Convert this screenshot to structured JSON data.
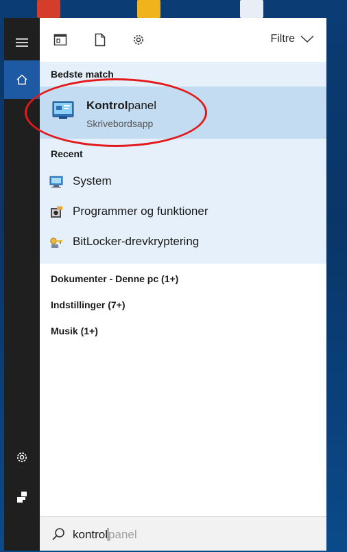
{
  "toolbar": {
    "filter_label": "Filtre"
  },
  "best_match": {
    "title": "Bedste match",
    "item": {
      "title_bold": "Kontrol",
      "title_rest": "panel",
      "subtitle": "Skrivebordsapp"
    }
  },
  "recent": {
    "title": "Recent",
    "items": [
      {
        "label": "System",
        "icon": "system-monitor-icon"
      },
      {
        "label": "Programmer og funktioner",
        "icon": "programs-features-icon"
      },
      {
        "label": "BitLocker-drevkryptering",
        "icon": "bitlocker-key-icon"
      }
    ]
  },
  "categories": [
    "Dokumenter - Denne pc (1+)",
    "Indstillinger (7+)",
    "Musik (1+)"
  ],
  "search": {
    "typed": "kontrol",
    "suggestion": "panel"
  },
  "colors": {
    "accent": "#1e5aa3",
    "rail": "#1f1f1f",
    "results_bg": "#e6f0fa",
    "selected_bg": "#c3dcf1",
    "annotation": "#e11b1b"
  }
}
